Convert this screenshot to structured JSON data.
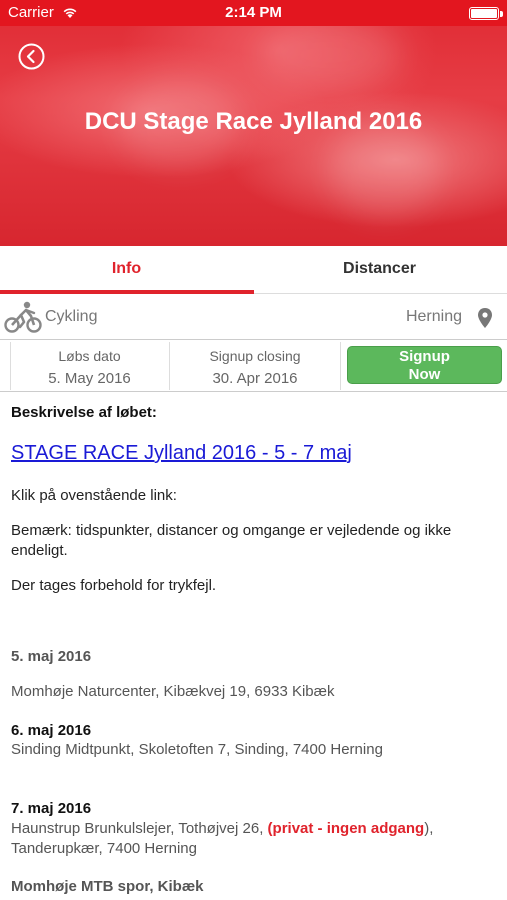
{
  "status_bar": {
    "carrier": "Carrier",
    "time": "2:14 PM"
  },
  "header": {
    "title": "DCU Stage Race Jylland 2016",
    "back_icon": "back-circle-icon",
    "accent_color": "#e0232c"
  },
  "tabs": [
    {
      "label": "Info",
      "active": true
    },
    {
      "label": "Distancer",
      "active": false
    }
  ],
  "category": {
    "label": "Cykling",
    "icon": "cyclist-icon",
    "location": "Herning",
    "location_icon": "map-pin-icon"
  },
  "race_info": {
    "date_label": "Løbs dato",
    "date_value": "5. May 2016",
    "closing_label": "Signup closing",
    "closing_value": "30. Apr 2016",
    "signup_line1": "Signup",
    "signup_line2": "Now",
    "signup_color": "#5cb85c"
  },
  "description": {
    "heading": "Beskrivelse af løbet:",
    "link_text": "STAGE RACE Jylland 2016 - 5 - 7 maj",
    "p1": "Klik på ovenstående link:",
    "p2": "Bemærk: tidspunkter, distancer og omgange er vejledende og ikke endeligt.",
    "p3": "Der tages forbehold for trykfejl.",
    "day1_date": "5. maj 2016",
    "day1_place": "Momhøje Naturcenter, Kibækvej 19, 6933 Kibæk",
    "day2_date": "6. maj 2016",
    "day2_place": "Sinding Midtpunkt, Skoletoften 7, Sinding, 7400 Herning",
    "day3_date": "7. maj 2016",
    "day3_place_a": "Haunstrup Brunkulslejer, Tothøjvej 26, ",
    "day3_place_warning": "(privat - ingen adgang",
    "day3_place_b": "),",
    "day3_place_c": "Tanderupkær, 7400 Herning",
    "mtb_heading": "Momhøje MTB spor, Kibæk"
  }
}
